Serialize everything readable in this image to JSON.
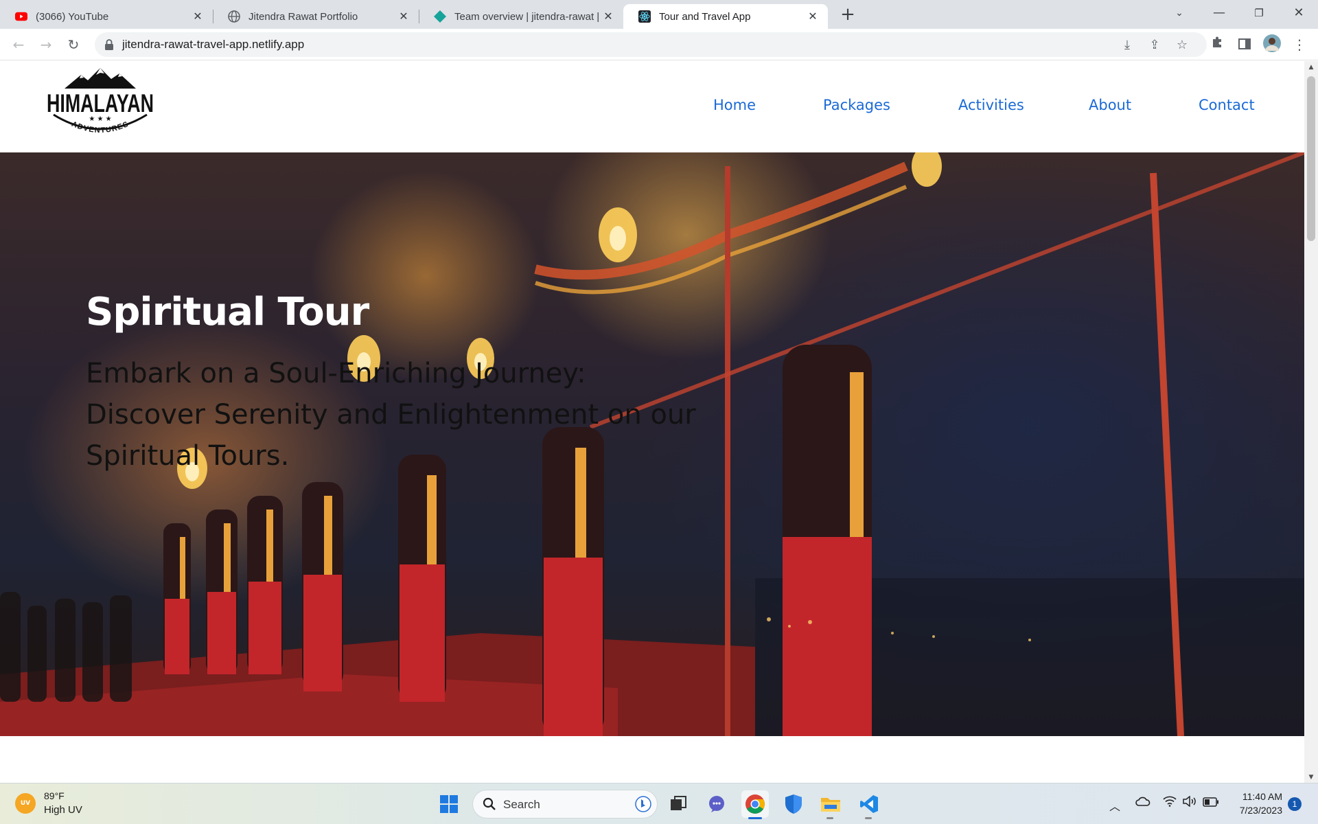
{
  "browser": {
    "tabs": [
      {
        "title": "(3066) YouTube",
        "icon": "youtube-icon",
        "active": false
      },
      {
        "title": "Jitendra Rawat Portfolio",
        "icon": "globe-icon",
        "active": false
      },
      {
        "title": "Team overview | jitendra-rawat | N",
        "icon": "netlify-icon",
        "active": false
      },
      {
        "title": "Tour and Travel App",
        "icon": "react-icon",
        "active": true
      }
    ],
    "new_tab_label": "+",
    "url": "jitendra-rawat-travel-app.netlify.app"
  },
  "site": {
    "logo": {
      "word": "HIMALAYAN",
      "sub": "ADVENTURES"
    },
    "nav": [
      "Home",
      "Packages",
      "Activities",
      "About",
      "Contact"
    ],
    "link_color": "#1a6ad6"
  },
  "hero": {
    "title": "Spiritual Tour",
    "text": "Embark on a Soul-Enriching Journey: Discover Serenity and Enlightenment on our Spiritual Tours."
  },
  "taskbar": {
    "weather": {
      "badge": "UV",
      "temp": "89°F",
      "desc": "High UV"
    },
    "search_label": "Search",
    "time": "11:40 AM",
    "date": "7/23/2023",
    "notifications": "1",
    "apps": [
      "windows-start-icon",
      "search-icon",
      "copilot-icon",
      "task-view-icon",
      "teams-icon",
      "chrome-icon",
      "defender-icon",
      "file-explorer-icon",
      "vscode-icon"
    ]
  }
}
